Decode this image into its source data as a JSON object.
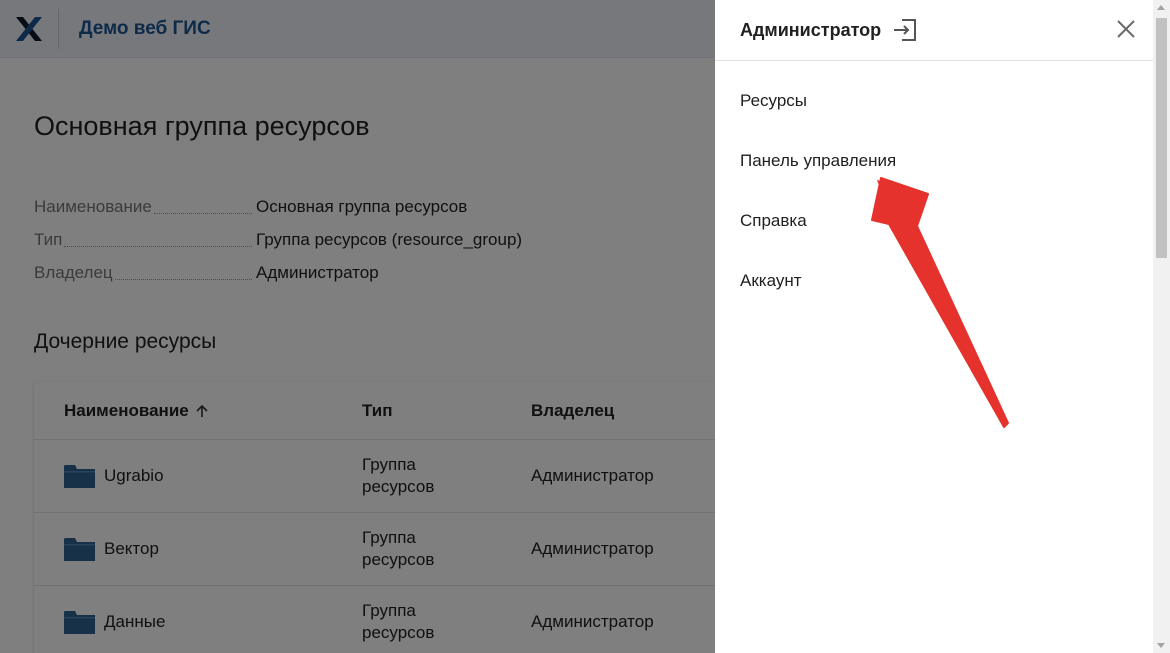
{
  "header": {
    "app_title": "Демо веб ГИС"
  },
  "page": {
    "title": "Основная группа ресурсов",
    "properties": [
      {
        "label": "Наименование",
        "value": "Основная группа ресурсов"
      },
      {
        "label": "Тип",
        "value": "Группа ресурсов (resource_group)"
      },
      {
        "label": "Владелец",
        "value": "Администратор"
      }
    ],
    "children_title": "Дочерние ресурсы",
    "table": {
      "columns": [
        "Наименование",
        "Тип",
        "Владелец"
      ],
      "sort_icon": "arrow-up-icon",
      "rows": [
        {
          "name": "Ugrabio",
          "type": "Группа ресурсов",
          "owner": "Администратор",
          "icon": "folder-icon"
        },
        {
          "name": "Вектор",
          "type": "Группа ресурсов",
          "owner": "Администратор",
          "icon": "folder-icon"
        },
        {
          "name": "Данные",
          "type": "Группа ресурсов",
          "owner": "Администратор",
          "icon": "folder-icon"
        }
      ]
    }
  },
  "drawer": {
    "user_name": "Администратор",
    "logout_icon": "logout-icon",
    "close_icon": "close-icon",
    "menu": [
      {
        "label": "Ресурсы"
      },
      {
        "label": "Панель управления"
      },
      {
        "label": "Справка"
      },
      {
        "label": "Аккаунт"
      }
    ]
  },
  "colors": {
    "brand": "#1a5493",
    "folder": "#2f6390",
    "annotation_arrow": "#e5322d",
    "overlay": "rgba(0,0,0,0.5)"
  }
}
